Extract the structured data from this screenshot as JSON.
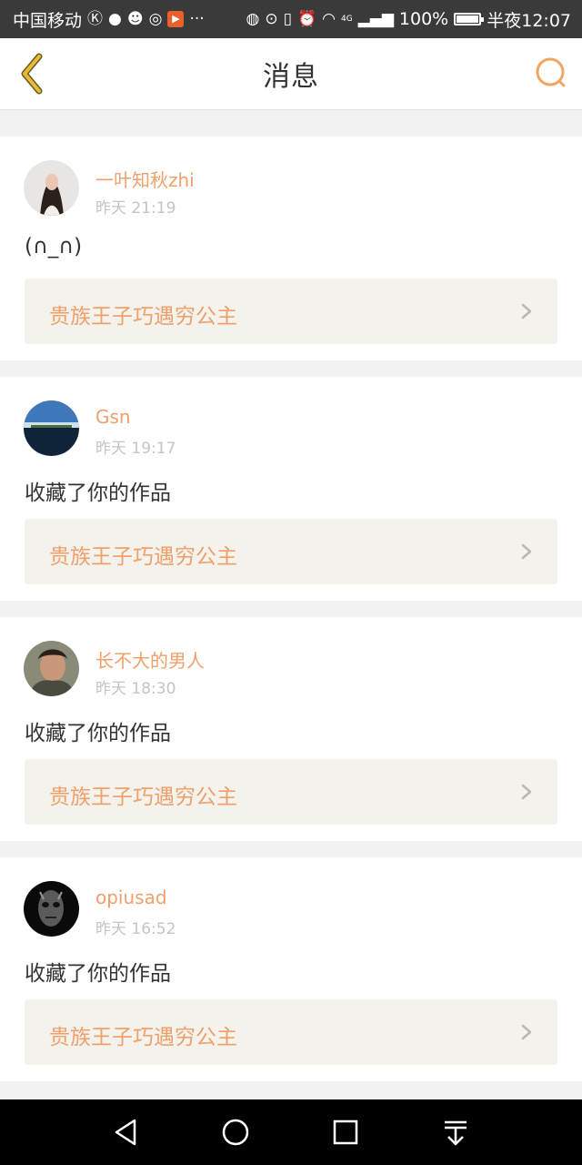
{
  "status_bar": {
    "carrier": "中国移动",
    "battery": "100%",
    "time": "半夜12:07",
    "network": "4G"
  },
  "header": {
    "title": "消息",
    "back_icon": "chevron-left-icon",
    "search_icon": "search-icon"
  },
  "colors": {
    "accent": "#f0a06b",
    "icon_accent": "#f2a561",
    "back_icon": "#e8b93a"
  },
  "notifications": [
    {
      "username": "一叶知秋zhi",
      "time": "昨天 21:19",
      "content": "(∩_∩)",
      "work_title": "贵族王子巧遇穷公主"
    },
    {
      "username": "Gsn",
      "time": "昨天 19:17",
      "content": "收藏了你的作品",
      "work_title": "贵族王子巧遇穷公主"
    },
    {
      "username": "长不大的男人",
      "time": "昨天 18:30",
      "content": "收藏了你的作品",
      "work_title": "贵族王子巧遇穷公主"
    },
    {
      "username": "opiusad",
      "time": "昨天 16:52",
      "content": "收藏了你的作品",
      "work_title": "贵族王子巧遇穷公主"
    }
  ],
  "nav": {
    "back": "triangle-back-icon",
    "home": "circle-home-icon",
    "recent": "square-recent-icon",
    "notifications": "pull-down-icon"
  }
}
